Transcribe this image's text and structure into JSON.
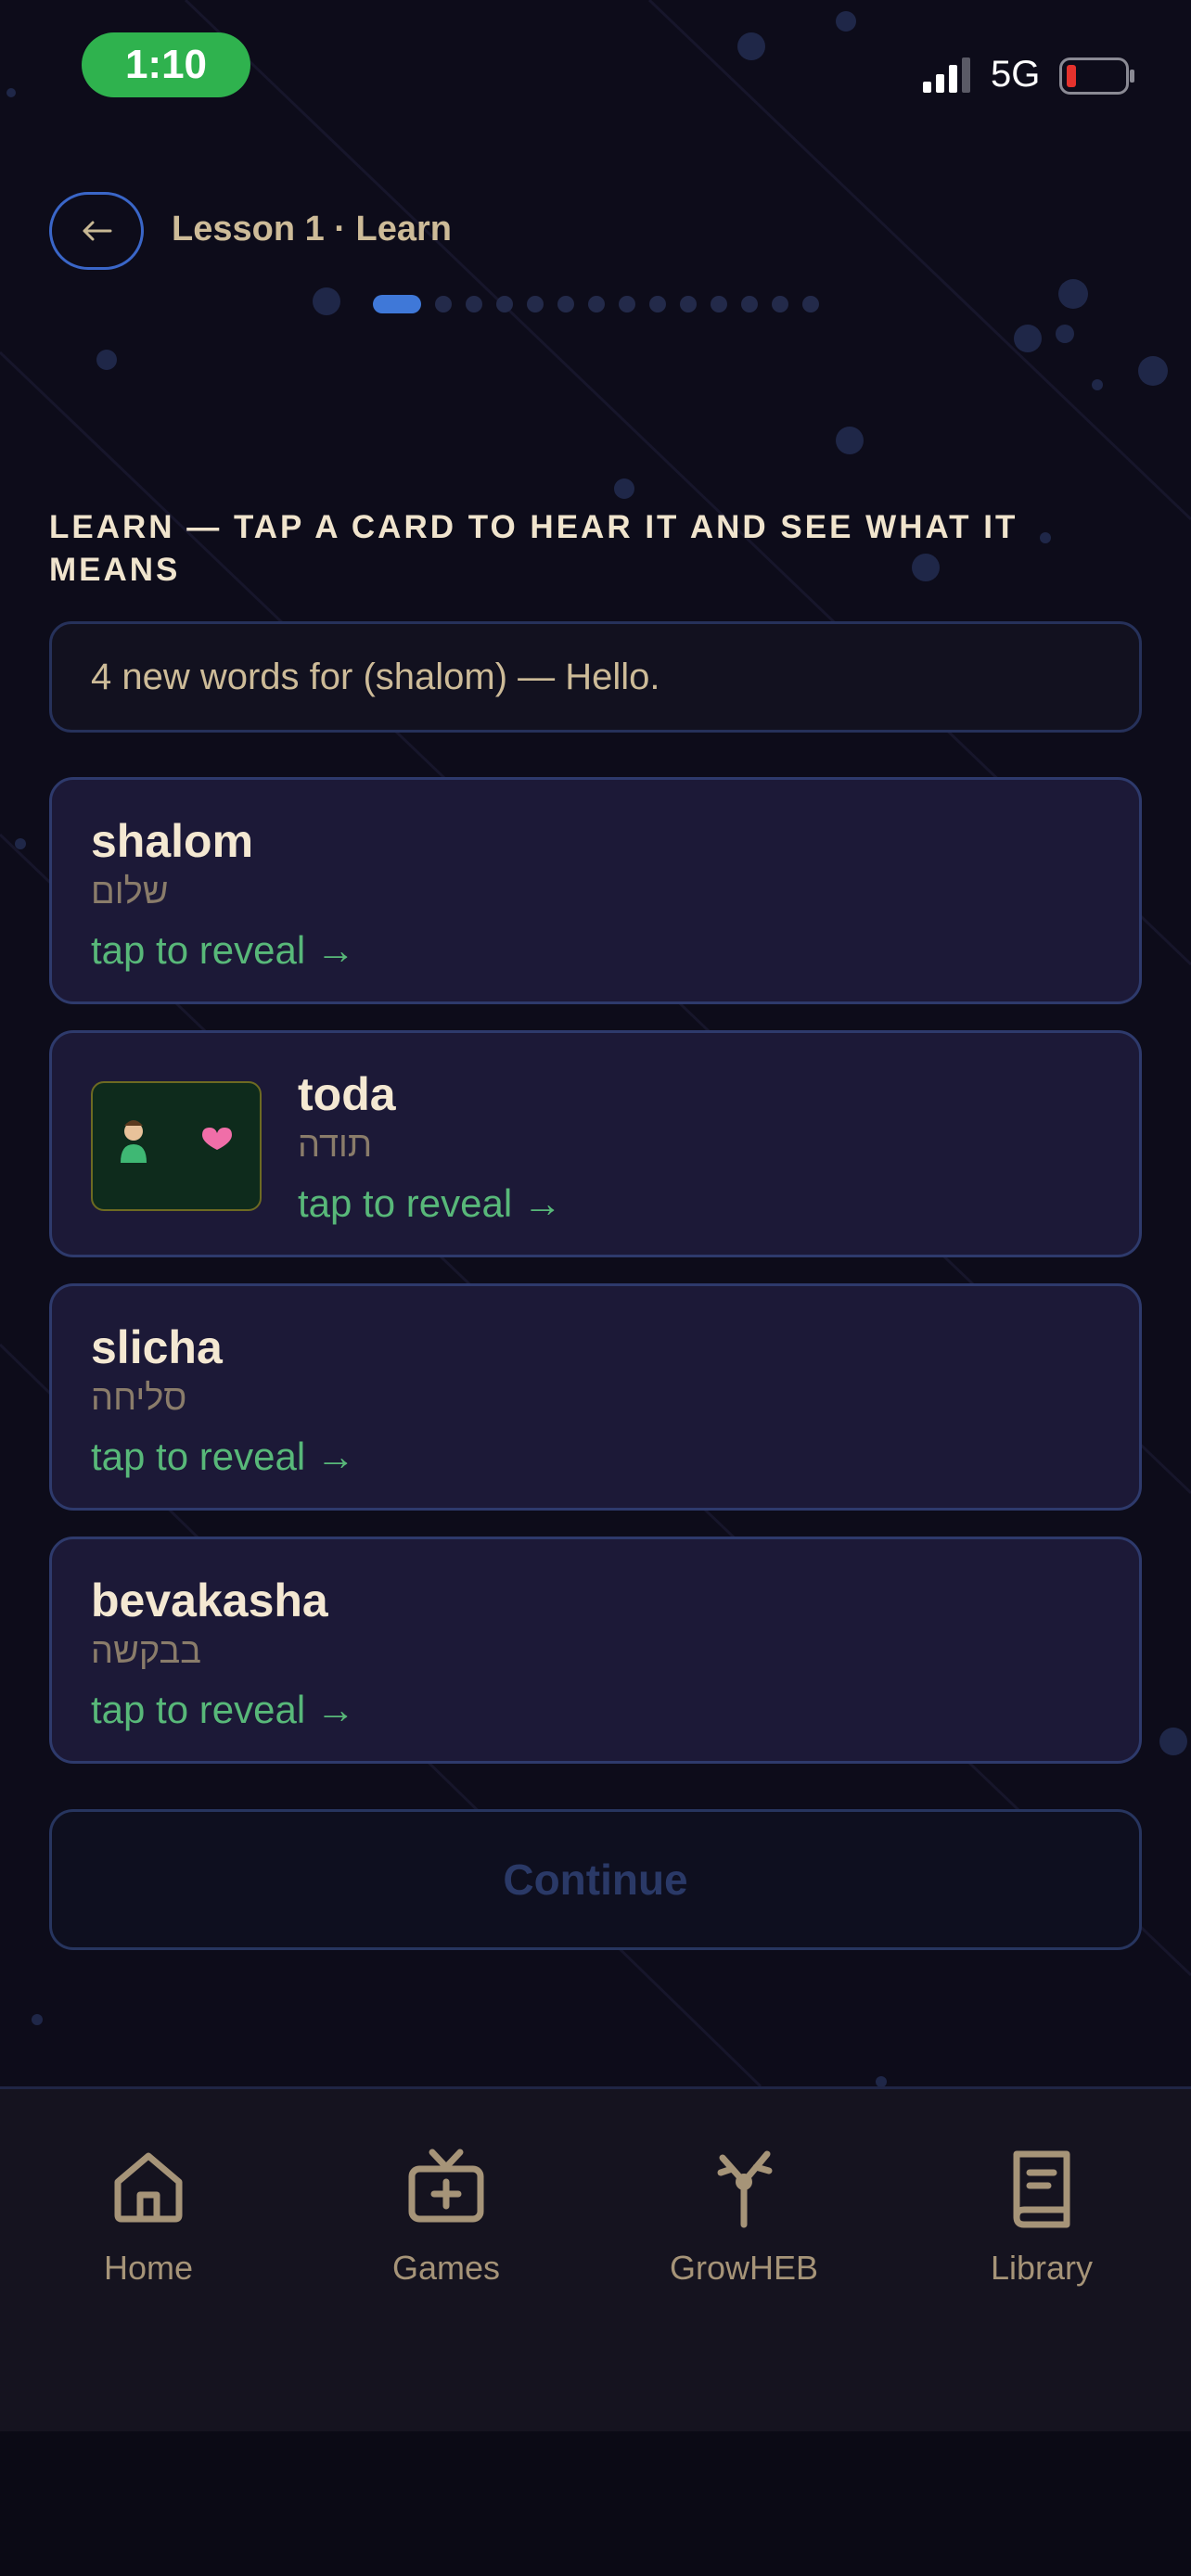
{
  "status_bar": {
    "time": "1:10",
    "network": "5G"
  },
  "header": {
    "back_icon": "arrow-left-icon",
    "title": "Lesson 1 · Learn",
    "progress": {
      "current": 1,
      "total": 14
    }
  },
  "instruction": "LEARN — TAP A CARD TO HEAR IT AND SEE WHAT IT MEANS",
  "intro": "4 new words for (shalom) — Hello.",
  "cards": [
    {
      "word": "shalom",
      "hebrew": "שלום",
      "reveal": "tap to reveal →"
    },
    {
      "word": "toda",
      "hebrew": "תודה",
      "reveal": "tap to reveal →",
      "image": "person-heart-illustration"
    },
    {
      "word": "slicha",
      "hebrew": "סליחה",
      "reveal": "tap to reveal →"
    },
    {
      "word": "bevakasha",
      "hebrew": "בבקשה",
      "reveal": "tap to reveal →"
    }
  ],
  "continue_label": "Continue",
  "nav": [
    {
      "label": "Home",
      "icon": "home-icon"
    },
    {
      "label": "Games",
      "icon": "tv-games-icon"
    },
    {
      "label": "GrowHEB",
      "icon": "sprout-icon"
    },
    {
      "label": "Library",
      "icon": "book-icon"
    }
  ],
  "colors": {
    "background": "#0d0c1a",
    "card": "#1c1937",
    "accent_blue": "#3f78d8",
    "reveal_green": "#58b879",
    "time_pill": "#2fb24e"
  }
}
